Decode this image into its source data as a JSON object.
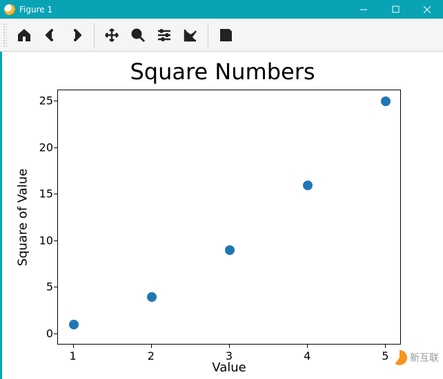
{
  "window": {
    "title": "Figure 1",
    "controls": {
      "min": "minimize",
      "max": "maximize",
      "close": "close"
    }
  },
  "toolbar": {
    "home": "Home",
    "back": "Back",
    "forward": "Forward",
    "pan": "Pan",
    "zoom": "Zoom",
    "subplots": "Configure subplots",
    "edit": "Edit axis",
    "save": "Save"
  },
  "chart_data": {
    "type": "scatter",
    "title": "Square Numbers",
    "xlabel": "Value",
    "ylabel": "Square of Value",
    "x": [
      1,
      2,
      3,
      4,
      5
    ],
    "y": [
      1,
      4,
      9,
      16,
      25
    ],
    "xticks": [
      1,
      2,
      3,
      4,
      5
    ],
    "yticks": [
      0,
      5,
      10,
      15,
      20,
      25
    ],
    "xlim": [
      0.8,
      5.2
    ],
    "ylim": [
      -1.2,
      26.2
    ],
    "marker_color": "#1f77b4"
  },
  "watermark": {
    "text": "新互联"
  }
}
